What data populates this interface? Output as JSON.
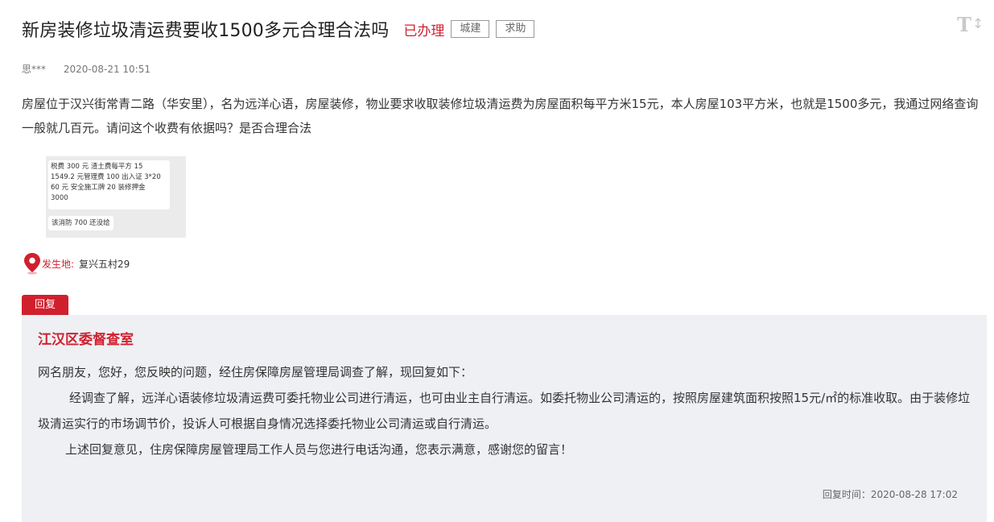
{
  "header": {
    "title": "新房装修垃圾清运费要收1500多元合理合法吗",
    "status": "已办理",
    "tags": [
      "城建",
      "求助"
    ],
    "font_toggle_icon": "text-size-icon"
  },
  "post": {
    "author": "思***",
    "datetime": "2020-08-21 10:51",
    "content": "房屋位于汉兴街常青二路（华安里），名为远洋心语，房屋装修，物业要求收取装修垃圾清运费为房屋面积每平方米15元，本人房屋103平方米，也就是1500多元，我通过网络查询一般就几百元。请问这个收费有依据吗？是否合理合法",
    "attachment": {
      "lines": [
        "税费 300 元 渣土费每平方 15",
        "1549.2 元管理费 100 出入证 3*20",
        "60 元 安全施工牌 20 装修押金",
        "3000"
      ],
      "line2": "该消防 700 还没给"
    },
    "location_label": "发生地:",
    "location_value": "复兴五村29",
    "location_icon": "map-pin-icon"
  },
  "reply": {
    "tab_label": "回复",
    "org": "江汉区委督查室",
    "paragraphs": [
      "网名朋友，您好，您反映的问题，经住房保障房屋管理局调查了解，现回复如下：",
      "经调查了解，远洋心语装修垃圾清运费可委托物业公司进行清运，也可由业主自行清运。如委托物业公司清运的，按照房屋建筑面积按照15元/㎡的标准收取。由于装修垃圾清运实行的市场调节价，投诉人可根据自身情况选择委托物业公司清运或自行清运。",
      "上述回复意见，住房保障房屋管理局工作人员与您进行电话沟通，您表示满意，感谢您的留言！"
    ],
    "time": "回复时间：2020-08-28 17:02"
  },
  "colors": {
    "accent": "#d0202e",
    "reply_bg": "#eef0f4"
  }
}
